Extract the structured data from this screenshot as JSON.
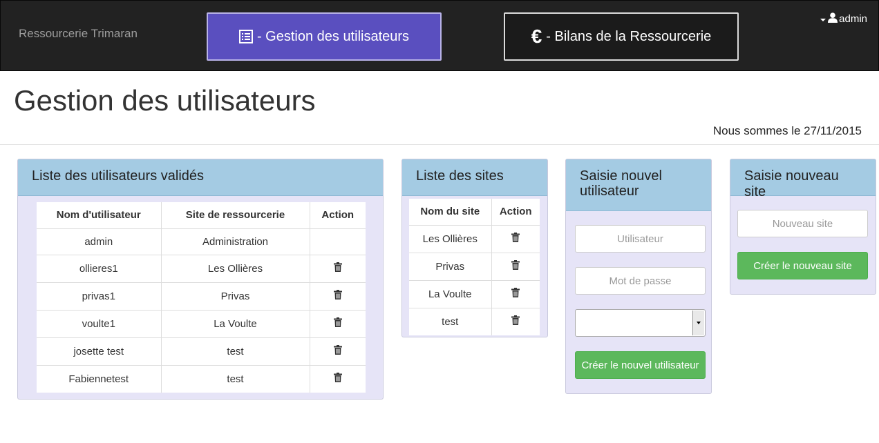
{
  "navbar": {
    "brand": "Ressourcerie Trimaran",
    "gestion_label": "- Gestion des utilisateurs",
    "bilans_symbol": "€",
    "bilans_label": "- Bilans de la Ressourcerie",
    "user_label": "admin"
  },
  "page": {
    "title": "Gestion des utilisateurs",
    "date": "Nous sommes le 27/11/2015"
  },
  "users_panel": {
    "title": "Liste des utilisateurs validés",
    "columns": [
      "Nom d'utilisateur",
      "Site de ressourcerie",
      "Action"
    ],
    "rows": [
      {
        "name": "admin",
        "site": "Administration",
        "deletable": false
      },
      {
        "name": "ollieres1",
        "site": "Les Ollières",
        "deletable": true
      },
      {
        "name": "privas1",
        "site": "Privas",
        "deletable": true
      },
      {
        "name": "voulte1",
        "site": "La Voulte",
        "deletable": true
      },
      {
        "name": "josette test",
        "site": "test",
        "deletable": true
      },
      {
        "name": "Fabiennetest",
        "site": "test",
        "deletable": true
      }
    ]
  },
  "sites_panel": {
    "title": "Liste des sites",
    "columns": [
      "Nom du site",
      "Action"
    ],
    "rows": [
      {
        "name": "Les Ollières"
      },
      {
        "name": "Privas"
      },
      {
        "name": "La Voulte"
      },
      {
        "name": "test"
      }
    ]
  },
  "new_user_panel": {
    "title": "Saisie nouvel utilisateur",
    "user_placeholder": "Utilisateur",
    "password_placeholder": "Mot de passe",
    "site_select_value": "",
    "submit_label": "Créer le nouvel utilisateur"
  },
  "new_site_panel": {
    "title": "Saisie nouveau site",
    "site_placeholder": "Nouveau site",
    "submit_label": "Créer le nouveau site"
  },
  "colors": {
    "navbar_bg": "#222222",
    "active_nav": "#5a4fbf",
    "panel_head": "#a4cbe3",
    "panel_body": "#e6e4f7",
    "success": "#5cb85c"
  }
}
